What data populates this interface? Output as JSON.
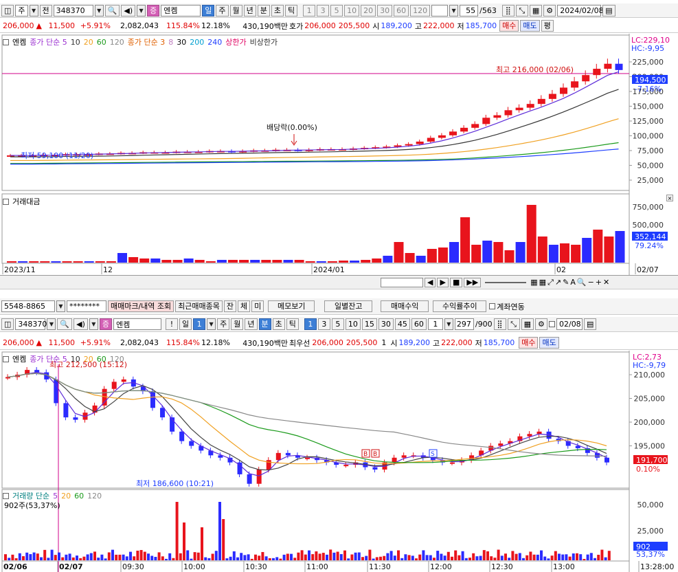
{
  "top_toolbar": {
    "market": "주",
    "prev_label": "전",
    "code": "348370",
    "name_badge": "증",
    "name": "엔켐",
    "periods": [
      "일",
      "주",
      "월",
      "년",
      "분",
      "초",
      "틱"
    ],
    "active_period": "일",
    "nums": [
      "1",
      "3",
      "5",
      "10",
      "20",
      "30",
      "60",
      "120"
    ],
    "count": "55",
    "total": "/563",
    "date": "2024/02/08"
  },
  "quote1": {
    "price": "206,000",
    "change": "11,500",
    "rate": "+5.91%",
    "volume": "2,082,043",
    "vol_rate": "115.84%",
    "turnover": "12.18%",
    "amount": "430,190백만",
    "hoga_label": "호가",
    "ask": "206,000",
    "bid": "205,500",
    "open_label": "시",
    "open": "189,200",
    "high_label": "고",
    "high": "222,000",
    "low_label": "저",
    "low": "185,700",
    "buy": "매수",
    "sell": "매도",
    "eval": "평"
  },
  "daily_chart": {
    "legend": {
      "name": "엔켐",
      "ma5": "종가 단순 5",
      "ma5_periods": [
        "10",
        "20",
        "60",
        "120"
      ],
      "ma3": "종가 단순 3",
      "ma3_periods": [
        "8",
        "30",
        "200",
        "240"
      ],
      "upper": "상한가",
      "nonupper": "비상한가"
    },
    "lc": "LC:229,10",
    "hc": "HC:-9,95",
    "y_ticks": [
      "225,000",
      "200,000",
      "175,000",
      "150,000",
      "125,000",
      "100,000",
      "75,000",
      "50,000",
      "25,000"
    ],
    "price_tag": "194,500",
    "pct_tag": "-7.16%",
    "max_label": "최고 216,000 (02/06)",
    "min_label": "최저 59,100 (11/20)",
    "dividend": "배당락(0.00%)",
    "vol_title": "거래대금",
    "vol_ticks": [
      "750,000",
      "500,000"
    ],
    "vol_tag": "352,144",
    "vol_pct": "79.24%",
    "dates": [
      "2023/11",
      "12",
      "2024/01",
      "02",
      "02/07"
    ]
  },
  "account_bar": {
    "account": "5548-8865",
    "password": "********",
    "btns": [
      "매매마크/내역 조회",
      "최근매매종목",
      "잔",
      "체",
      "미",
      "메모보기",
      "일별잔고",
      "매매수익",
      "수익률추이"
    ],
    "link": "계좌연동"
  },
  "mid_toolbar": {
    "code": "348370",
    "name": "엔켐",
    "bang": "!",
    "period": "일",
    "sel": "1",
    "periods": [
      "주",
      "월",
      "년",
      "분",
      "초",
      "틱"
    ],
    "nums": [
      "1",
      "3",
      "5",
      "10",
      "15",
      "30",
      "45",
      "60"
    ],
    "input": "1",
    "count": "297",
    "total": "/900",
    "date": "02/08"
  },
  "quote2": {
    "price": "206,000",
    "change": "11,500",
    "rate": "+5.91%",
    "volume": "2,082,043",
    "vol_rate": "115.84%",
    "turnover": "12.18%",
    "amount": "430,190백만",
    "best_label": "최우선",
    "ask": "206,000",
    "bid": "205,500",
    "qty": "1",
    "open_label": "시",
    "open": "189,200",
    "high_label": "고",
    "high": "222,000",
    "low_label": "저",
    "low": "185,700",
    "buy": "매수",
    "sell": "매도"
  },
  "minute_chart": {
    "legend": {
      "name": "엔켐",
      "ma": "종가 단순 5",
      "periods": [
        "10",
        "20",
        "60",
        "120"
      ]
    },
    "lc": "LC:2,73",
    "hc": "HC:-9,79",
    "y_ticks": [
      "210,000",
      "205,000",
      "200,000",
      "195,000"
    ],
    "max_label": "최고 212,500 (15:12)",
    "min_label": "최저 186,600 (10:21)",
    "price_tag": "191,700",
    "pct_tag": "0.10%",
    "vol_title": "거래량 단순",
    "vol_periods": [
      "5",
      "20",
      "60",
      "120"
    ],
    "vol_sub": "902주(53,37%)",
    "vol_ticks": [
      "50,000",
      "25,000"
    ],
    "vol_tag": "902",
    "vol_pct": "53,37%",
    "times": [
      "02/06",
      "02/07",
      "09:30",
      "10:00",
      "10:30",
      "11:00",
      "11:30",
      "12:00",
      "12:30",
      "13:00",
      "13:28:00"
    ]
  },
  "colors": {
    "up": "#e8141c",
    "down": "#2b2bff",
    "ma5": "#5c2bd8",
    "ma20": "#f0a020",
    "ma60": "#1a9a1a",
    "ma120": "#222222"
  }
}
